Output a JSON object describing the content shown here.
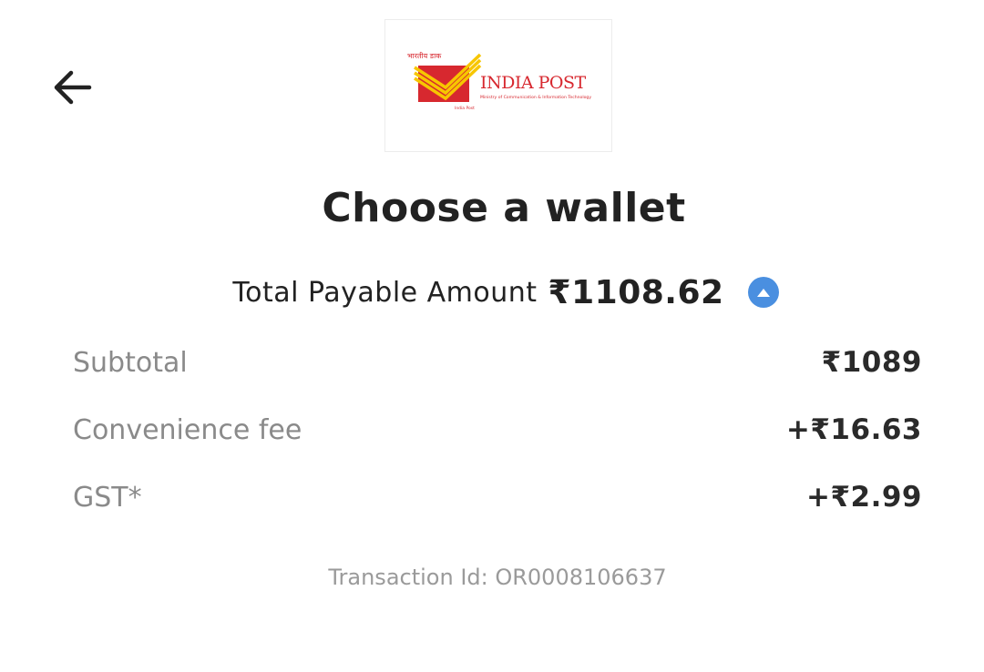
{
  "header": {
    "back_icon": "arrow-left-icon",
    "logo": {
      "hindi_text": "भारतीय डाक",
      "brand_name": "INDIA POST",
      "subtitle": "Ministry of Communication & Information Technology",
      "caption": "India Post",
      "colors": {
        "red": "#d7282f",
        "yellow": "#f7c600"
      }
    }
  },
  "title": "Choose a wallet",
  "total": {
    "label": "Total Payable Amount",
    "amount": "₹1108.62",
    "toggle_icon": "chevron-up-circle-icon",
    "toggle_color": "#4a8fe0"
  },
  "breakdown": [
    {
      "label": "Subtotal",
      "value": "₹1089"
    },
    {
      "label": "Convenience fee",
      "value": "+₹16.63"
    },
    {
      "label": "GST*",
      "value": "+₹2.99"
    }
  ],
  "transaction": "Transaction Id: OR0008106637"
}
